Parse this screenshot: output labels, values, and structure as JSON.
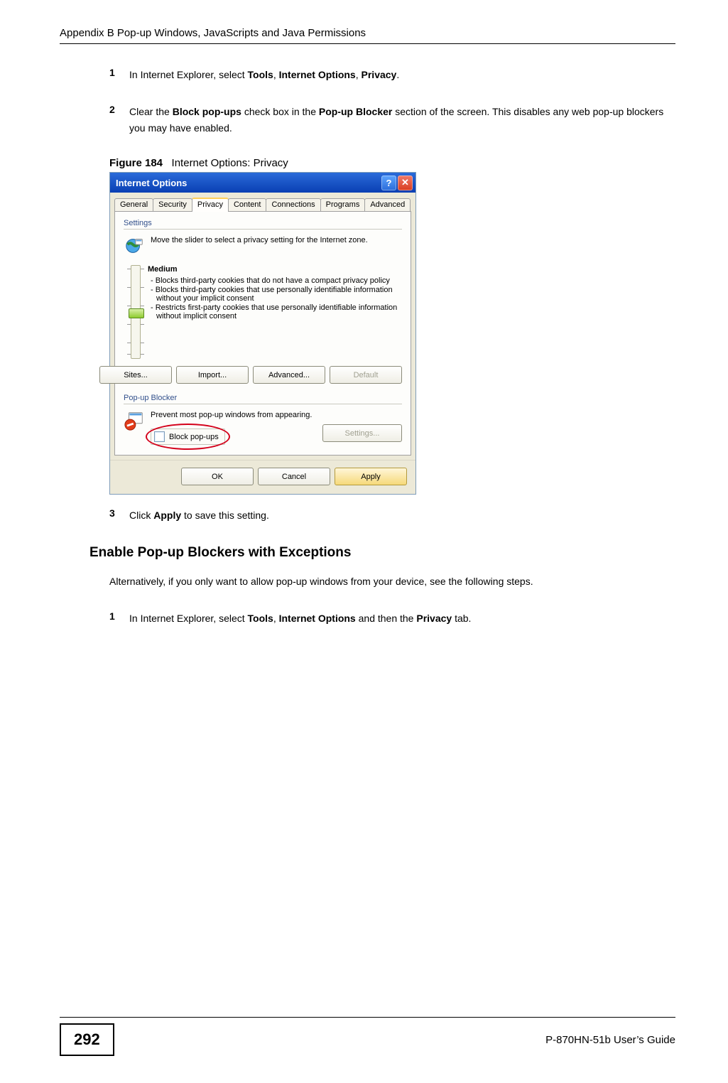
{
  "header": {
    "running_head": "Appendix B Pop-up Windows, JavaScripts and Java Permissions"
  },
  "steps": {
    "s1_num": "1",
    "s1_a": "In Internet Explorer, select ",
    "s1_b": "Tools",
    "s1_c": ", ",
    "s1_d": "Internet Options",
    "s1_e": ", ",
    "s1_f": "Privacy",
    "s1_g": ".",
    "s2_num": "2",
    "s2_a": "Clear the ",
    "s2_b": "Block pop-ups",
    "s2_c": " check box in the ",
    "s2_d": "Pop-up Blocker",
    "s2_e": " section of the screen. This disables any web pop-up blockers you may have enabled.",
    "fig_label": "Figure 184",
    "fig_caption": "Internet Options: Privacy",
    "s3_num": "3",
    "s3_a": "Click ",
    "s3_b": "Apply",
    "s3_c": " to save this setting."
  },
  "h2": "Enable Pop-up Blockers with Exceptions",
  "alt_para": "Alternatively, if you only want to allow pop-up windows from your device, see the following steps.",
  "steps2": {
    "s1_num": "1",
    "s1_a": "In Internet Explorer, select ",
    "s1_b": "Tools",
    "s1_c": ", ",
    "s1_d": "Internet Options",
    "s1_e": " and then the ",
    "s1_f": "Privacy",
    "s1_g": " tab."
  },
  "dialog": {
    "title": "Internet Options",
    "help_glyph": "?",
    "close_glyph": "✕",
    "tabs": [
      "General",
      "Security",
      "Privacy",
      "Content",
      "Connections",
      "Programs",
      "Advanced"
    ],
    "active_tab_index": 2,
    "settings_title": "Settings",
    "settings_desc": "Move the slider to select a privacy setting for the Internet zone.",
    "level_name": "Medium",
    "level_bullets": [
      "Blocks third-party cookies that do not have a compact privacy policy",
      "Blocks third-party cookies that use personally identifiable information without your implicit consent",
      "Restricts first-party cookies that use personally identifiable information without implicit consent"
    ],
    "btn_sites": "Sites...",
    "btn_import": "Import...",
    "btn_advanced": "Advanced...",
    "btn_default": "Default",
    "popup_title": "Pop-up Blocker",
    "popup_desc": "Prevent most pop-up windows from appearing.",
    "block_popups_label": "Block pop-ups",
    "btn_settings": "Settings...",
    "btn_ok": "OK",
    "btn_cancel": "Cancel",
    "btn_apply": "Apply"
  },
  "footer": {
    "page_number": "292",
    "guide": "P-870HN-51b User’s Guide"
  }
}
